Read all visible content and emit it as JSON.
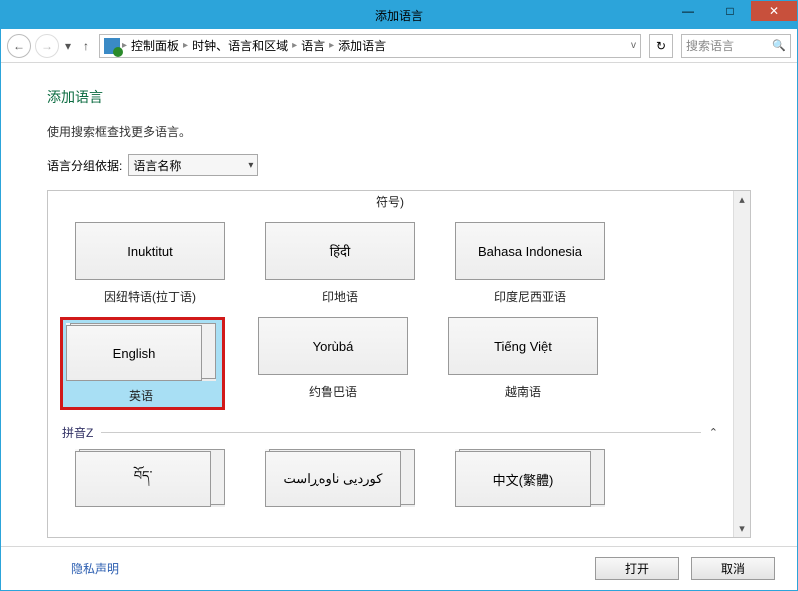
{
  "window": {
    "title": "添加语言"
  },
  "wincontrols": {
    "min": "—",
    "max": "□",
    "close": "✕"
  },
  "nav": {
    "back": "←",
    "fwd": "→",
    "dd": "▾",
    "up": "↑",
    "refresh": "↻",
    "search_placeholder": "搜索语言",
    "search_icon": "🔍",
    "addr_dd": "v"
  },
  "breadcrumbs": {
    "items": [
      "控制面板",
      "时钟、语言和区域",
      "语言",
      "添加语言"
    ],
    "sep": "▸"
  },
  "page": {
    "heading": "添加语言",
    "hint": "使用搜索框查找更多语言。",
    "group_label": "语言分组依据:",
    "group_value": "语言名称"
  },
  "selection_marker": "3",
  "top_trunc": "符号)",
  "tiles": {
    "row1": [
      {
        "native": "Inuktitut",
        "label": "因纽特语(拉丁语)",
        "double": false
      },
      {
        "native": "हिंदी",
        "label": "印地语",
        "double": false
      },
      {
        "native": "Bahasa Indonesia",
        "label": "印度尼西亚语",
        "double": false
      }
    ],
    "row2": [
      {
        "native": "English",
        "label": "英语",
        "double": true,
        "selected": true
      },
      {
        "native": "Yorùbá",
        "label": "约鲁巴语",
        "double": false
      },
      {
        "native": "Tiếng Việt",
        "label": "越南语",
        "double": false
      }
    ],
    "group_header": "拼音Z",
    "row3": [
      {
        "native": "བོད་",
        "label": "",
        "double": true
      },
      {
        "native": "کوردیی ناوەڕاست",
        "label": "",
        "double": true
      },
      {
        "native": "中文(繁體)",
        "label": "",
        "double": true
      }
    ]
  },
  "footer": {
    "privacy": "隐私声明",
    "open": "打开",
    "cancel": "取消"
  }
}
